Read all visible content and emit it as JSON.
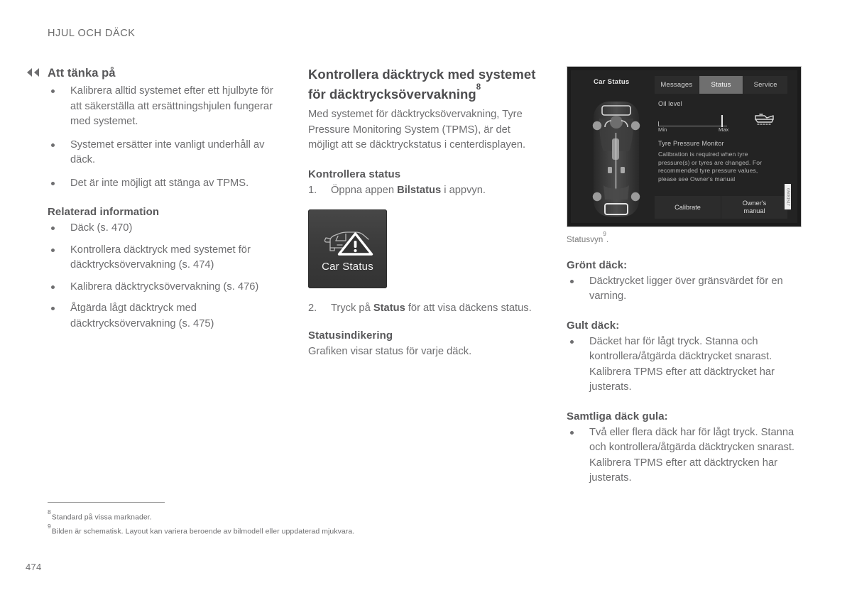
{
  "running_head": "HJUL OCH DÄCK",
  "page_number": "474",
  "nav": {
    "back_icon": "double-chevron-left-icon"
  },
  "left_column": {
    "heading": "Att tänka på",
    "bullets": [
      "Kalibrera alltid systemet efter ett hjulbyte för att säkerställa att ersättningshjulen fungerar med systemet.",
      "Systemet ersätter inte vanligt underhåll av däck.",
      "Det är inte möjligt att stänga av TPMS."
    ],
    "related_heading": "Relaterad information",
    "related_links": [
      "Däck (s. 470)",
      "Kontrollera däcktryck med systemet för däcktrycksövervakning (s. 474)",
      "Kalibrera däcktrycksövervakning (s. 476)",
      "Åtgärda lågt däcktryck med däcktrycksövervakning (s. 475)"
    ]
  },
  "middle_column": {
    "title": "Kontrollera däcktryck med systemet för däcktrycksövervakning",
    "title_footnote": "8",
    "intro": "Med systemet för däcktrycksövervakning, Tyre Pressure Monitoring System (TPMS), är det möjligt att se däcktryckstatus i centerdisplayen.",
    "status_heading": "Kontrollera status",
    "step1": {
      "num": "1.",
      "pre": "Öppna appen ",
      "bold": "Bilstatus",
      "post": " i appvyn."
    },
    "app_tile": {
      "label": "Car Status",
      "icon": "car-warning-icon"
    },
    "step2": {
      "num": "2.",
      "pre": "Tryck på ",
      "bold": "Status",
      "post": " för att visa däckens status."
    },
    "indication_heading": "Statusindikering",
    "indication_text": "Grafiken visar status för varje däck."
  },
  "right_column": {
    "screen": {
      "title": "Car Status",
      "tabs": [
        {
          "label": "Messages",
          "active": false
        },
        {
          "label": "Status",
          "active": true
        },
        {
          "label": "Service",
          "active": false
        }
      ],
      "oil_level_label": "Oil level",
      "gauge_min": "Min",
      "gauge_max": "Max",
      "oil_can_icon": "oil-can-icon",
      "car_graphic_icon": "car-top-view-icon",
      "tpm_label": "Tyre Pressure Monitor",
      "tpm_text": "Calibration is required when tyre pressure(s) or tyres are changed. For recommended tyre pressure values, please see Owner's manual",
      "buttons": [
        "Calibrate",
        "Owner's\nmanual"
      ],
      "figure_code": "G5081517"
    },
    "caption": "Statusvyn",
    "caption_footnote": "9",
    "caption_suffix": ".",
    "green_heading": "Grönt däck:",
    "green_bullets": [
      "Däcktrycket ligger över gränsvärdet för en varning."
    ],
    "yellow_heading": "Gult däck:",
    "yellow_bullets": [
      "Däcket har för lågt tryck. Stanna och kontrollera/åtgärda däcktrycket snarast. Kalibrera TPMS efter att däcktrycket har justerats."
    ],
    "all_yellow_heading": "Samtliga däck gula:",
    "all_yellow_bullets": [
      "Två eller flera däck har för lågt tryck. Stanna och kontrollera/åtgärda däcktrycken snarast. Kalibrera TPMS efter att däcktrycken har justerats."
    ]
  },
  "footnotes": [
    {
      "marker": "8",
      "text": "Standard på vissa marknader."
    },
    {
      "marker": "9",
      "text": "Bilden är schematisk. Layout kan variera beroende av bilmodell eller uppdaterad mjukvara."
    }
  ],
  "colors": {
    "text": "#6e6e70",
    "heading": "#58585a",
    "screen_bg": "#232323",
    "tab_active": "#6f6f6f"
  }
}
